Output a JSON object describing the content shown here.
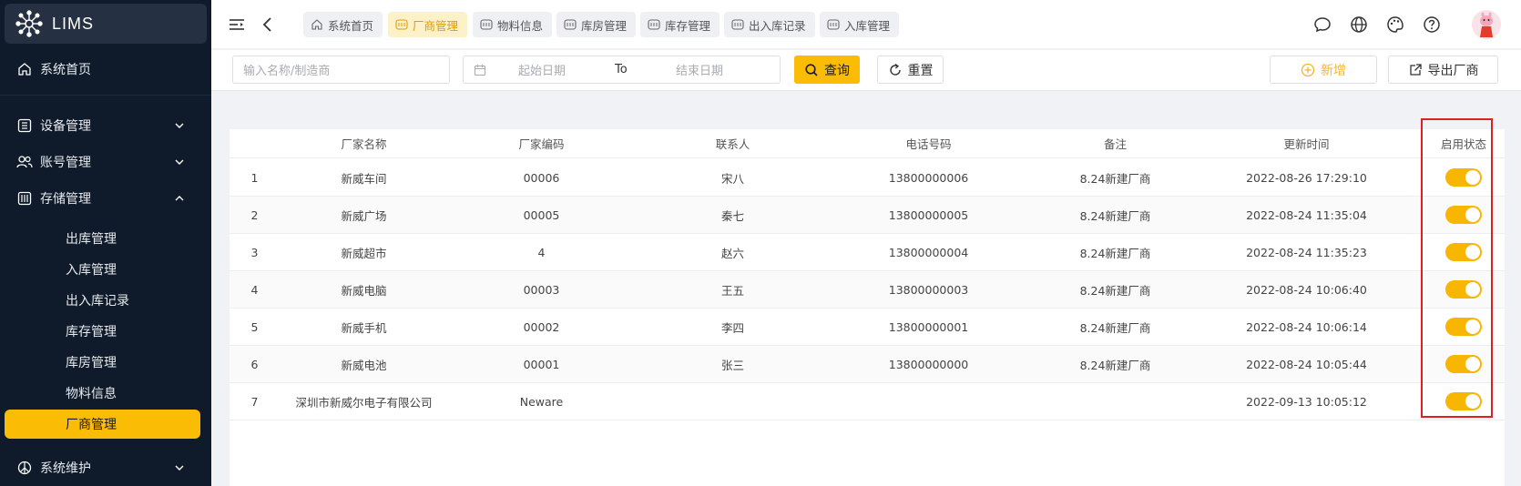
{
  "app": {
    "logo_text": "LIMS"
  },
  "sidebar": {
    "home": "系统首页",
    "groups": [
      {
        "label": "设备管理"
      },
      {
        "label": "账号管理"
      },
      {
        "label": "存储管理"
      }
    ],
    "sub_items": [
      "出库管理",
      "入库管理",
      "出入库记录",
      "库存管理",
      "库房管理",
      "物料信息",
      "厂商管理"
    ],
    "active_sub": "厂商管理",
    "maintenance": "系统维护"
  },
  "tabs": [
    {
      "label": "系统首页",
      "active": false
    },
    {
      "label": "厂商管理",
      "active": true
    },
    {
      "label": "物料信息",
      "active": false
    },
    {
      "label": "库房管理",
      "active": false
    },
    {
      "label": "库存管理",
      "active": false
    },
    {
      "label": "出入库记录",
      "active": false
    },
    {
      "label": "入库管理",
      "active": false
    }
  ],
  "filter": {
    "search_placeholder": "输入名称/制造商",
    "start_placeholder": "起始日期",
    "range_separator": "To",
    "end_placeholder": "结束日期",
    "query_label": "查询",
    "reset_label": "重置",
    "add_label": "新增",
    "export_label": "导出厂商"
  },
  "table": {
    "columns": [
      "厂家名称",
      "厂家编码",
      "联系人",
      "电话号码",
      "备注",
      "更新时间",
      "启用状态"
    ],
    "rows": [
      {
        "index": "1",
        "name": "新威车间",
        "code": "00006",
        "contact": "宋八",
        "phone": "13800000006",
        "note": "8.24新建厂商",
        "updated": "2022-08-26 17:29:10",
        "enabled": true
      },
      {
        "index": "2",
        "name": "新威广场",
        "code": "00005",
        "contact": "秦七",
        "phone": "13800000005",
        "note": "8.24新建厂商",
        "updated": "2022-08-24 11:35:04",
        "enabled": true
      },
      {
        "index": "3",
        "name": "新威超市",
        "code": "4",
        "contact": "赵六",
        "phone": "13800000004",
        "note": "8.24新建厂商",
        "updated": "2022-08-24 11:35:23",
        "enabled": true
      },
      {
        "index": "4",
        "name": "新威电脑",
        "code": "00003",
        "contact": "王五",
        "phone": "13800000003",
        "note": "8.24新建厂商",
        "updated": "2022-08-24 10:06:40",
        "enabled": true
      },
      {
        "index": "5",
        "name": "新威手机",
        "code": "00002",
        "contact": "李四",
        "phone": "13800000001",
        "note": "8.24新建厂商",
        "updated": "2022-08-24 10:06:14",
        "enabled": true
      },
      {
        "index": "6",
        "name": "新威电池",
        "code": "00001",
        "contact": "张三",
        "phone": "13800000000",
        "note": "8.24新建厂商",
        "updated": "2022-08-24 10:05:44",
        "enabled": true
      },
      {
        "index": "7",
        "name": "深圳市新威尔电子有限公司",
        "code": "Neware",
        "contact": "",
        "phone": "",
        "note": "",
        "updated": "2022-09-13 10:05:12",
        "enabled": true
      }
    ]
  },
  "colors": {
    "sidebar_bg": "#0f1b2a",
    "accent": "#fbbc05",
    "toggle_on": "#f8b600",
    "highlight": "#e02020"
  }
}
